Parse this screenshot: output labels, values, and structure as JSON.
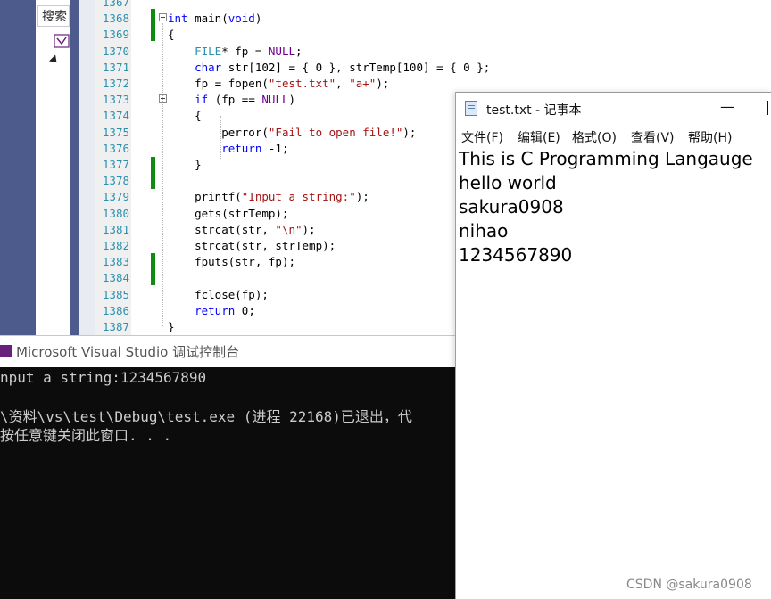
{
  "sidebar": {
    "search_label": "搜索"
  },
  "editor": {
    "lines": [
      {
        "n": "1367",
        "code": ""
      },
      {
        "n": "1368",
        "code": "int main(void)"
      },
      {
        "n": "1369",
        "code": "{"
      },
      {
        "n": "1370",
        "code": "    FILE* fp = NULL;"
      },
      {
        "n": "1371",
        "code": "    char str[102] = { 0 }, strTemp[100] = { 0 };"
      },
      {
        "n": "1372",
        "code": "    fp = fopen(\"test.txt\", \"a+\");"
      },
      {
        "n": "1373",
        "code": "    if (fp == NULL)"
      },
      {
        "n": "1374",
        "code": "    {"
      },
      {
        "n": "1375",
        "code": "        perror(\"Fail to open file!\");"
      },
      {
        "n": "1376",
        "code": "        return -1;"
      },
      {
        "n": "1377",
        "code": "    }"
      },
      {
        "n": "1378",
        "code": ""
      },
      {
        "n": "1379",
        "code": "    printf(\"Input a string:\");"
      },
      {
        "n": "1380",
        "code": "    gets(strTemp);"
      },
      {
        "n": "1381",
        "code": "    strcat(str, \"\\n\");"
      },
      {
        "n": "1382",
        "code": "    strcat(str, strTemp);"
      },
      {
        "n": "1383",
        "code": "    fputs(str, fp);"
      },
      {
        "n": "1384",
        "code": ""
      },
      {
        "n": "1385",
        "code": "    fclose(fp);"
      },
      {
        "n": "1386",
        "code": "    return 0;"
      },
      {
        "n": "1387",
        "code": "}"
      }
    ]
  },
  "console": {
    "title": "Microsoft Visual Studio 调试控制台",
    "lines": [
      "nput a string:1234567890",
      "",
      "\\资料\\vs\\test\\Debug\\test.exe (进程 22168)已退出，代",
      "按任意键关闭此窗口. . ."
    ]
  },
  "notepad": {
    "title": "test.txt - 记事本",
    "menu": [
      "文件(F)",
      "编辑(E)",
      "格式(O)",
      "查看(V)",
      "帮助(H)"
    ],
    "content": [
      "This is C Programming Langauge",
      "hello world",
      "sakura0908",
      "nihao",
      "1234567890"
    ]
  },
  "watermark": "CSDN @sakura0908"
}
